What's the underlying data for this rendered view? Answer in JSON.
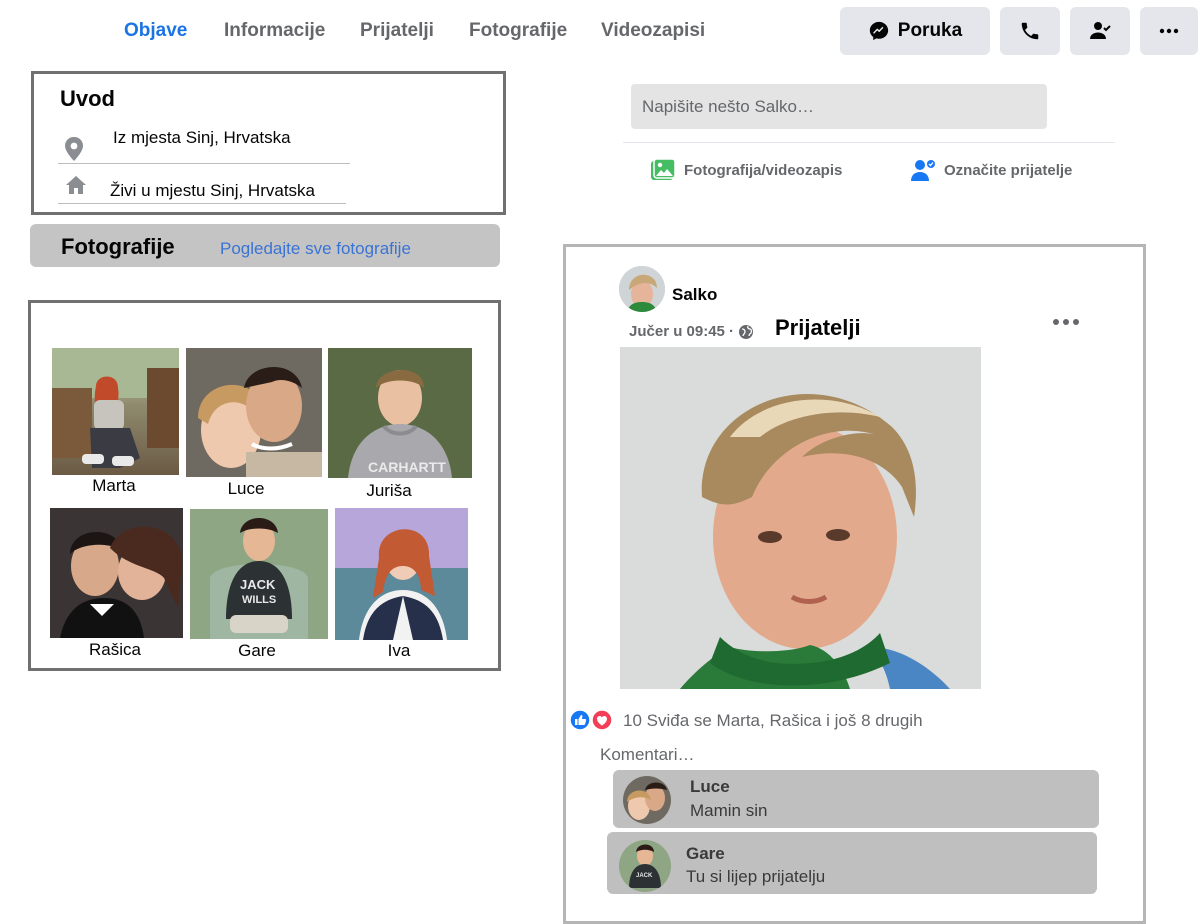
{
  "nav": {
    "tabs": [
      {
        "label": "Objave",
        "active": true
      },
      {
        "label": "Informacije",
        "active": false
      },
      {
        "label": "Prijatelji",
        "active": false
      },
      {
        "label": "Fotografije",
        "active": false
      },
      {
        "label": "Videozapisi",
        "active": false
      }
    ],
    "message_label": "Poruka",
    "icons": {
      "message": "messenger-icon",
      "call": "phone-icon",
      "friend": "friend-check-icon",
      "more": "more-dots-icon"
    }
  },
  "intro": {
    "title": "Uvod",
    "from": "Iz mjesta Sinj, Hrvatska",
    "lives": "Živi u mjestu Sinj, Hrvatska"
  },
  "photos": {
    "title": "Fotografije",
    "link": "Pogledajte sve fotografije",
    "friends": [
      "Marta",
      "Luce",
      "Juriša",
      "Rašica",
      "Gare",
      "Iva"
    ]
  },
  "composer": {
    "placeholder": "Napišite nešto Salko…",
    "photo_video": "Fotografija/videozapis",
    "tag_friends": "Označite prijatelje"
  },
  "post": {
    "author": "Salko",
    "time": "Jučer u 09:45 ·",
    "title": "Prijatelji",
    "likes": "10 Sviđa se Marta, Rašica i još 8 drugih",
    "comments_label": "Komentari…",
    "comments": [
      {
        "name": "Luce",
        "text": "Mamin sin"
      },
      {
        "name": "Gare",
        "text": "Tu si lijep prijatelju"
      }
    ]
  },
  "colors": {
    "accent": "#1b74e4",
    "like_blue": "#1877f2",
    "heart_red": "#f33e58",
    "card_border": "#707070"
  }
}
